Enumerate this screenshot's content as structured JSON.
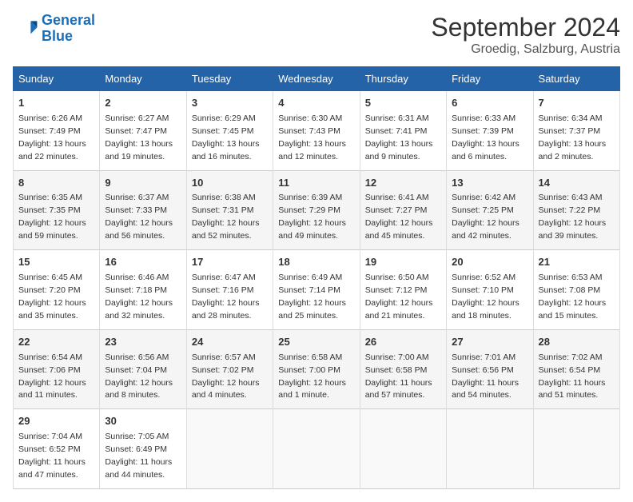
{
  "logo": {
    "line1": "General",
    "line2": "Blue"
  },
  "title": "September 2024",
  "location": "Groedig, Salzburg, Austria",
  "days_of_week": [
    "Sunday",
    "Monday",
    "Tuesday",
    "Wednesday",
    "Thursday",
    "Friday",
    "Saturday"
  ],
  "weeks": [
    [
      {
        "num": "1",
        "info": "Sunrise: 6:26 AM\nSunset: 7:49 PM\nDaylight: 13 hours\nand 22 minutes."
      },
      {
        "num": "2",
        "info": "Sunrise: 6:27 AM\nSunset: 7:47 PM\nDaylight: 13 hours\nand 19 minutes."
      },
      {
        "num": "3",
        "info": "Sunrise: 6:29 AM\nSunset: 7:45 PM\nDaylight: 13 hours\nand 16 minutes."
      },
      {
        "num": "4",
        "info": "Sunrise: 6:30 AM\nSunset: 7:43 PM\nDaylight: 13 hours\nand 12 minutes."
      },
      {
        "num": "5",
        "info": "Sunrise: 6:31 AM\nSunset: 7:41 PM\nDaylight: 13 hours\nand 9 minutes."
      },
      {
        "num": "6",
        "info": "Sunrise: 6:33 AM\nSunset: 7:39 PM\nDaylight: 13 hours\nand 6 minutes."
      },
      {
        "num": "7",
        "info": "Sunrise: 6:34 AM\nSunset: 7:37 PM\nDaylight: 13 hours\nand 2 minutes."
      }
    ],
    [
      {
        "num": "8",
        "info": "Sunrise: 6:35 AM\nSunset: 7:35 PM\nDaylight: 12 hours\nand 59 minutes."
      },
      {
        "num": "9",
        "info": "Sunrise: 6:37 AM\nSunset: 7:33 PM\nDaylight: 12 hours\nand 56 minutes."
      },
      {
        "num": "10",
        "info": "Sunrise: 6:38 AM\nSunset: 7:31 PM\nDaylight: 12 hours\nand 52 minutes."
      },
      {
        "num": "11",
        "info": "Sunrise: 6:39 AM\nSunset: 7:29 PM\nDaylight: 12 hours\nand 49 minutes."
      },
      {
        "num": "12",
        "info": "Sunrise: 6:41 AM\nSunset: 7:27 PM\nDaylight: 12 hours\nand 45 minutes."
      },
      {
        "num": "13",
        "info": "Sunrise: 6:42 AM\nSunset: 7:25 PM\nDaylight: 12 hours\nand 42 minutes."
      },
      {
        "num": "14",
        "info": "Sunrise: 6:43 AM\nSunset: 7:22 PM\nDaylight: 12 hours\nand 39 minutes."
      }
    ],
    [
      {
        "num": "15",
        "info": "Sunrise: 6:45 AM\nSunset: 7:20 PM\nDaylight: 12 hours\nand 35 minutes."
      },
      {
        "num": "16",
        "info": "Sunrise: 6:46 AM\nSunset: 7:18 PM\nDaylight: 12 hours\nand 32 minutes."
      },
      {
        "num": "17",
        "info": "Sunrise: 6:47 AM\nSunset: 7:16 PM\nDaylight: 12 hours\nand 28 minutes."
      },
      {
        "num": "18",
        "info": "Sunrise: 6:49 AM\nSunset: 7:14 PM\nDaylight: 12 hours\nand 25 minutes."
      },
      {
        "num": "19",
        "info": "Sunrise: 6:50 AM\nSunset: 7:12 PM\nDaylight: 12 hours\nand 21 minutes."
      },
      {
        "num": "20",
        "info": "Sunrise: 6:52 AM\nSunset: 7:10 PM\nDaylight: 12 hours\nand 18 minutes."
      },
      {
        "num": "21",
        "info": "Sunrise: 6:53 AM\nSunset: 7:08 PM\nDaylight: 12 hours\nand 15 minutes."
      }
    ],
    [
      {
        "num": "22",
        "info": "Sunrise: 6:54 AM\nSunset: 7:06 PM\nDaylight: 12 hours\nand 11 minutes."
      },
      {
        "num": "23",
        "info": "Sunrise: 6:56 AM\nSunset: 7:04 PM\nDaylight: 12 hours\nand 8 minutes."
      },
      {
        "num": "24",
        "info": "Sunrise: 6:57 AM\nSunset: 7:02 PM\nDaylight: 12 hours\nand 4 minutes."
      },
      {
        "num": "25",
        "info": "Sunrise: 6:58 AM\nSunset: 7:00 PM\nDaylight: 12 hours\nand 1 minute."
      },
      {
        "num": "26",
        "info": "Sunrise: 7:00 AM\nSunset: 6:58 PM\nDaylight: 11 hours\nand 57 minutes."
      },
      {
        "num": "27",
        "info": "Sunrise: 7:01 AM\nSunset: 6:56 PM\nDaylight: 11 hours\nand 54 minutes."
      },
      {
        "num": "28",
        "info": "Sunrise: 7:02 AM\nSunset: 6:54 PM\nDaylight: 11 hours\nand 51 minutes."
      }
    ],
    [
      {
        "num": "29",
        "info": "Sunrise: 7:04 AM\nSunset: 6:52 PM\nDaylight: 11 hours\nand 47 minutes."
      },
      {
        "num": "30",
        "info": "Sunrise: 7:05 AM\nSunset: 6:49 PM\nDaylight: 11 hours\nand 44 minutes."
      },
      {
        "num": "",
        "info": ""
      },
      {
        "num": "",
        "info": ""
      },
      {
        "num": "",
        "info": ""
      },
      {
        "num": "",
        "info": ""
      },
      {
        "num": "",
        "info": ""
      }
    ]
  ]
}
